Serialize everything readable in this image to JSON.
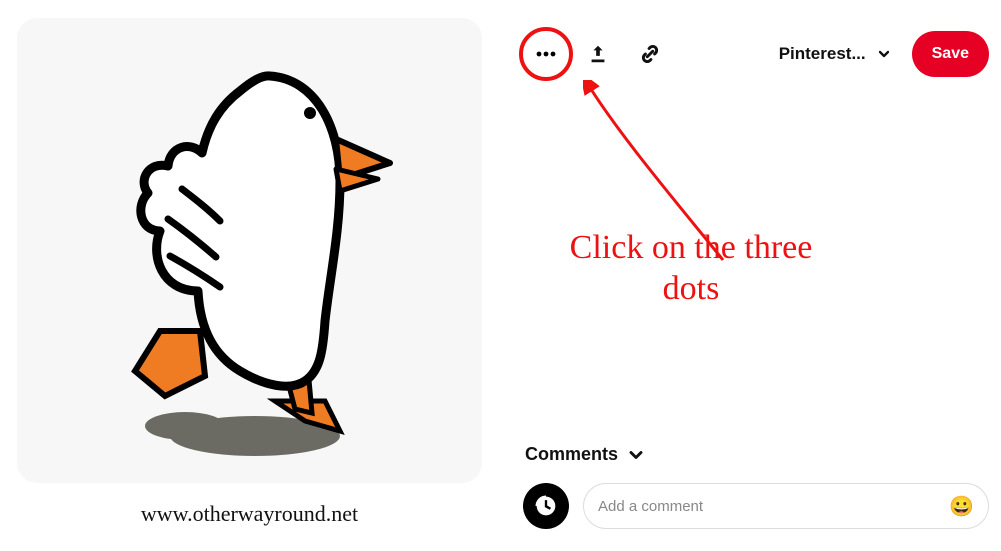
{
  "actions": {
    "board_label": "Pinterest...",
    "save_label": "Save"
  },
  "annotation": {
    "text": "Click on the three dots"
  },
  "comments": {
    "heading": "Comments",
    "placeholder": "Add a comment"
  },
  "credit": "www.otherwayround.net"
}
